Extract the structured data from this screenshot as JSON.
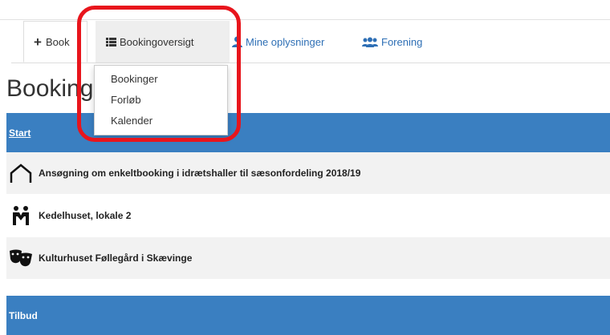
{
  "tabs": {
    "book_label": "Book",
    "overview_label": "Bookingoversigt",
    "mine_label": "Mine oplysninger",
    "forening_label": "Forening"
  },
  "dropdown": {
    "items": [
      "Bookinger",
      "Forløb",
      "Kalender"
    ]
  },
  "page": {
    "title": "Booking"
  },
  "start_section": {
    "header": "Start",
    "items": [
      {
        "label": "Ansøgning om enkeltbooking i idrætshaller til sæsonfordeling 2018/19",
        "icon": "arch-icon"
      },
      {
        "label": "Kedelhuset, lokale 2",
        "icon": "people-icon"
      },
      {
        "label": "Kulturhuset Føllegård i Skævinge",
        "icon": "theater-masks-icon"
      }
    ]
  },
  "tilbud_section": {
    "header": "Tilbud"
  },
  "colors": {
    "accent": "#3a7fc1",
    "highlight": "#e8151c",
    "link": "#2e6fb5"
  }
}
